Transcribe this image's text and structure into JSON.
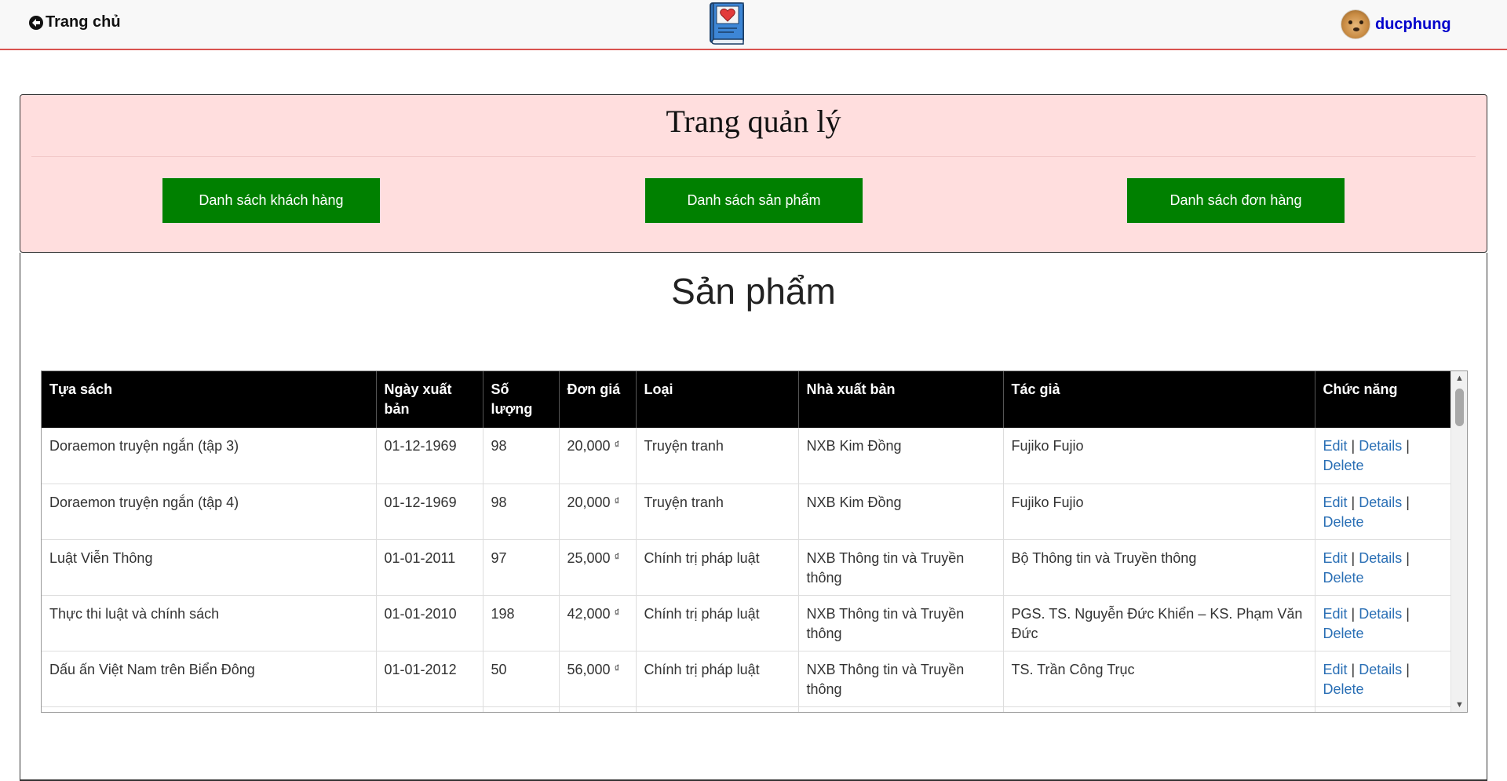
{
  "nav": {
    "home_label": "Trang chủ",
    "username": "ducphung"
  },
  "admin": {
    "title": "Trang quản lý",
    "buttons": [
      {
        "label": "Danh sách khách hàng"
      },
      {
        "label": "Danh sách sản phẩm"
      },
      {
        "label": "Danh sách đơn hàng"
      }
    ]
  },
  "products": {
    "title": "Sản phẩm",
    "currency_symbol": "₫",
    "columns": [
      "Tựa sách",
      "Ngày xuất bản",
      "Số lượng",
      "Đơn giá",
      "Loại",
      "Nhà xuất bản",
      "Tác giả",
      "Chức năng"
    ],
    "actions": {
      "edit": "Edit",
      "details": "Details",
      "delete": "Delete",
      "separator": "|"
    },
    "rows": [
      {
        "title": "Doraemon truyện ngắn (tập 3)",
        "date": "01-12-1969",
        "qty": "98",
        "price": "20,000",
        "category": "Truyện tranh",
        "publisher": "NXB Kim Đồng",
        "author": "Fujiko Fujio"
      },
      {
        "title": "Doraemon truyện ngắn (tập 4)",
        "date": "01-12-1969",
        "qty": "98",
        "price": "20,000",
        "category": "Truyện tranh",
        "publisher": "NXB Kim Đồng",
        "author": "Fujiko Fujio"
      },
      {
        "title": "Luật Viễn Thông",
        "date": "01-01-2011",
        "qty": "97",
        "price": "25,000",
        "category": "Chính trị pháp luật",
        "publisher": "NXB Thông tin và Truyền thông",
        "author": "Bộ Thông tin và Truyền thông"
      },
      {
        "title": "Thực thi luật và chính sách",
        "date": "01-01-2010",
        "qty": "198",
        "price": "42,000",
        "category": "Chính trị pháp luật",
        "publisher": "NXB Thông tin và Truyền thông",
        "author": "PGS. TS. Nguyễn Đức Khiển – KS. Phạm Văn Đức"
      },
      {
        "title": "Dấu ấn Việt Nam trên Biển Đông",
        "date": "01-01-2012",
        "qty": "50",
        "price": "56,000",
        "category": "Chính trị pháp luật",
        "publisher": "NXB Thông tin và Truyền thông",
        "author": "TS. Trần Công Trục"
      }
    ]
  },
  "colors": {
    "nav_border": "#d9534f",
    "admin_bg": "#ffdede",
    "button_bg": "#008000",
    "table_header_bg": "#000000",
    "link": "#2a6fb5",
    "username": "#0000cc"
  },
  "icons": {
    "home": "circle-arrow-left-icon",
    "logo": "book-heart-icon",
    "scroll_up": "triangle-up-icon",
    "scroll_down": "triangle-down-icon"
  }
}
